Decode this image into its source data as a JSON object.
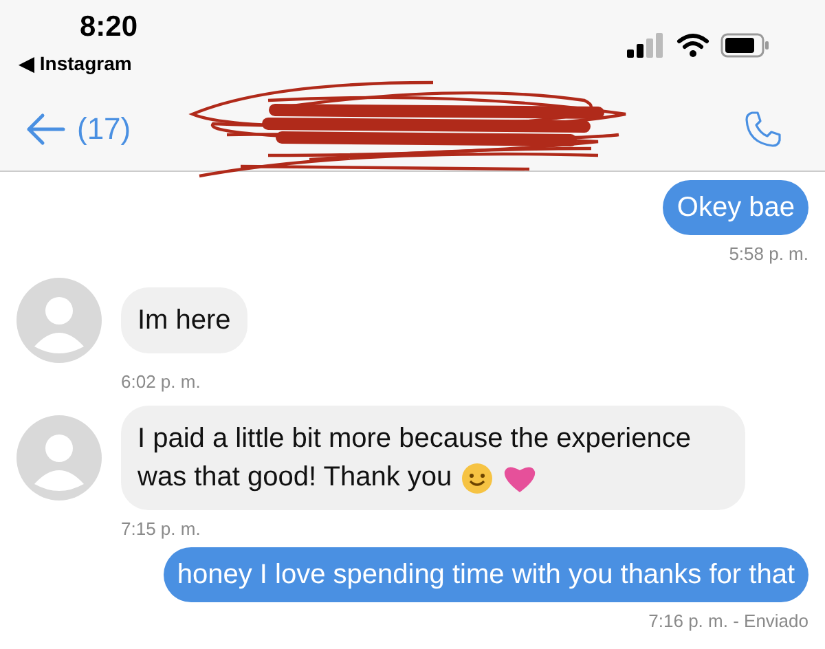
{
  "status_bar": {
    "time": "8:20",
    "back_app": "◀ Instagram"
  },
  "nav": {
    "unread_count": "(17)"
  },
  "messages": [
    {
      "kind": "sent",
      "text": "Okey bae",
      "time": "5:58 p. m."
    },
    {
      "kind": "received",
      "text": "Im here",
      "time": "6:02 p. m.",
      "emojis": false
    },
    {
      "kind": "received",
      "text": "I paid a little bit more because the experience was that good! Thank you",
      "time": "7:15 p. m.",
      "emojis": true
    },
    {
      "kind": "sent",
      "text": "honey I love spending time with you thanks for that",
      "time": "7:16 p. m. - Enviado"
    }
  ]
}
